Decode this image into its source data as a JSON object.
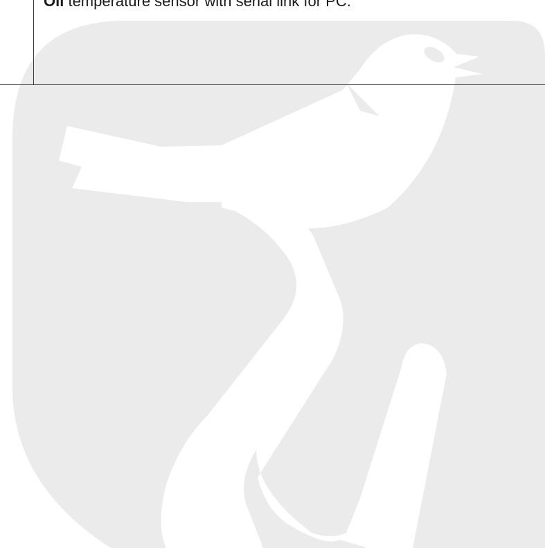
{
  "caption": {
    "lead": "Oil",
    "rest": " temperature sensor with serial link for PC."
  },
  "watermark": {
    "icon": "bird-logo-icon",
    "tile_color": "#ebebec",
    "bird_color": "#ffffff"
  }
}
